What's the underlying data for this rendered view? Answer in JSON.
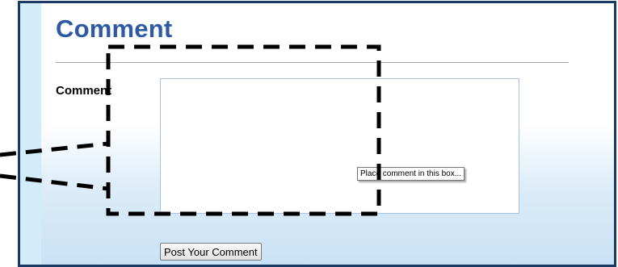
{
  "page": {
    "title": "Comment"
  },
  "form": {
    "comment_label": "Comment",
    "comment_value": "",
    "tooltip": "Place comment in this box...",
    "submit_label": "Post Your Comment"
  }
}
